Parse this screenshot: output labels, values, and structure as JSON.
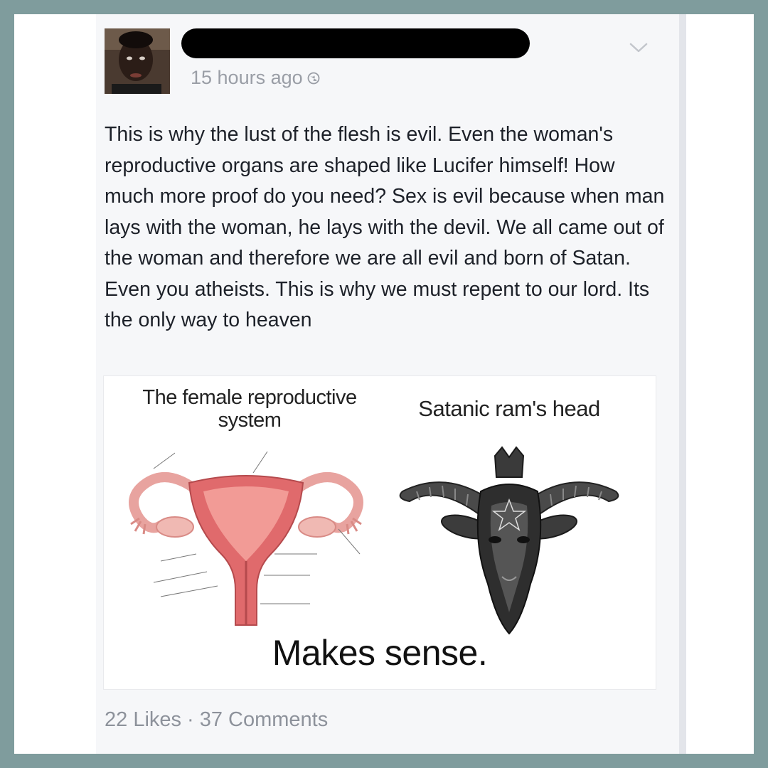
{
  "post": {
    "author_name": "",
    "timestamp": "15 hours ago",
    "body": "This is why the lust of the flesh is evil. Even the woman's reproductive organs are shaped like Lucifer himself! How much more proof do you need? Sex is evil because when man lays with the woman, he lays with the devil. We all came out of the woman and therefore we are all evil and born of Satan. Even you atheists. This is why we must repent to our lord. Its the only way to heaven"
  },
  "meme": {
    "left_caption": "The female reproductive system",
    "right_caption": "Satanic ram's head",
    "punchline": "Makes sense."
  },
  "stats": {
    "likes": "22 Likes",
    "separator": "·",
    "comments": "37 Comments"
  },
  "icons": {
    "privacy": "globe-icon",
    "menu": "chevron-down-icon"
  },
  "colors": {
    "border": "#7f9c9d",
    "meta_text": "#9a9ea6",
    "body_text": "#1d2129",
    "uterus": "#e06a6c"
  }
}
